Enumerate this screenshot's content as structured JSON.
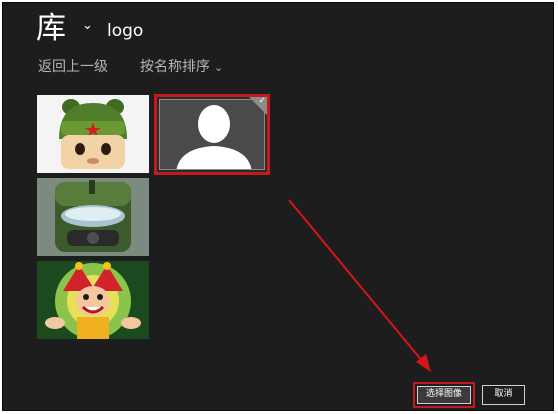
{
  "header": {
    "title": "库",
    "folder_name": "logo"
  },
  "toolbar": {
    "up_level": "返回上一级",
    "sort_by": "按名称排序"
  },
  "icons": {
    "title_dropdown": "chevron-down-icon",
    "sort_dropdown": "chevron-down-icon",
    "selected_check": "check-icon"
  },
  "files": [
    {
      "name": "soldier-bunny-icon",
      "selected": false
    },
    {
      "name": "default-user-avatar",
      "selected": true
    },
    {
      "name": "pilot-helmet-icon",
      "selected": false
    },
    {
      "name": "jester-clown-icon",
      "selected": false
    }
  ],
  "footer": {
    "select_label": "选择图像",
    "cancel_label": "取消"
  },
  "colors": {
    "background": "#1d1d1d",
    "highlight": "#c41a1f",
    "text_dim": "#b5b5b5"
  }
}
